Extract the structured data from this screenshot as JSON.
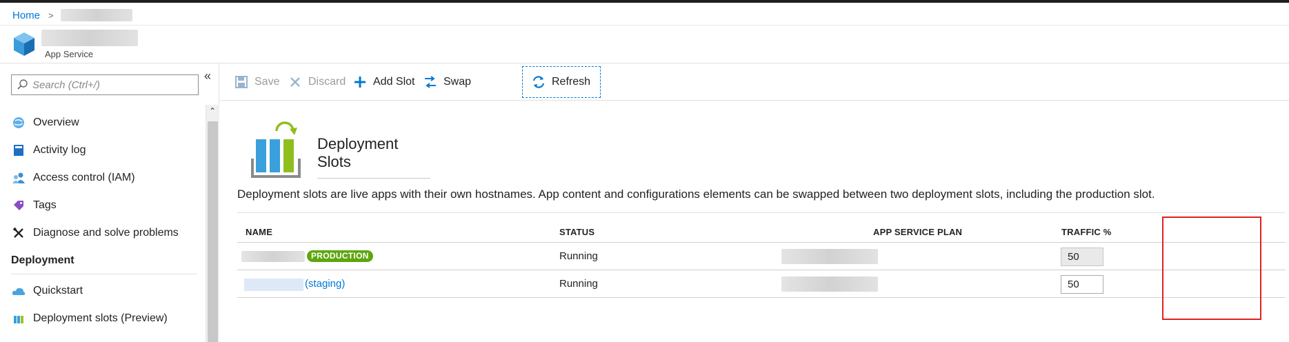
{
  "breadcrumb": {
    "home": "Home",
    "separator": ">"
  },
  "resource": {
    "type_label": "App Service"
  },
  "sidebar": {
    "search_placeholder": "Search (Ctrl+/)",
    "collapse_glyph": "«",
    "items": [
      {
        "label": "Overview",
        "icon": "globe-icon"
      },
      {
        "label": "Activity log",
        "icon": "book-icon"
      },
      {
        "label": "Access control (IAM)",
        "icon": "people-icon"
      },
      {
        "label": "Tags",
        "icon": "tag-icon"
      },
      {
        "label": "Diagnose and solve problems",
        "icon": "wrench-icon"
      }
    ],
    "deployment_section": "Deployment",
    "deployment_items": [
      {
        "label": "Quickstart",
        "icon": "cloud-icon"
      },
      {
        "label": "Deployment slots (Preview)",
        "icon": "slots-icon"
      }
    ]
  },
  "toolbar": {
    "save": "Save",
    "discard": "Discard",
    "add_slot": "Add Slot",
    "swap": "Swap",
    "refresh": "Refresh"
  },
  "page": {
    "title": "Deployment Slots",
    "description": "Deployment slots are live apps with their own hostnames. App content and configurations elements can be swapped between two deployment slots, including the production slot."
  },
  "table": {
    "headers": {
      "name": "NAME",
      "status": "STATUS",
      "plan": "APP SERVICE PLAN",
      "traffic": "TRAFFIC %"
    },
    "rows": [
      {
        "badge": "PRODUCTION",
        "status": "Running",
        "traffic": "50"
      },
      {
        "slot_suffix": "(staging)",
        "status": "Running",
        "traffic": "50"
      }
    ]
  },
  "colors": {
    "accent": "#0078d4",
    "production_badge": "#5ea60f",
    "highlight": "#e02020"
  }
}
